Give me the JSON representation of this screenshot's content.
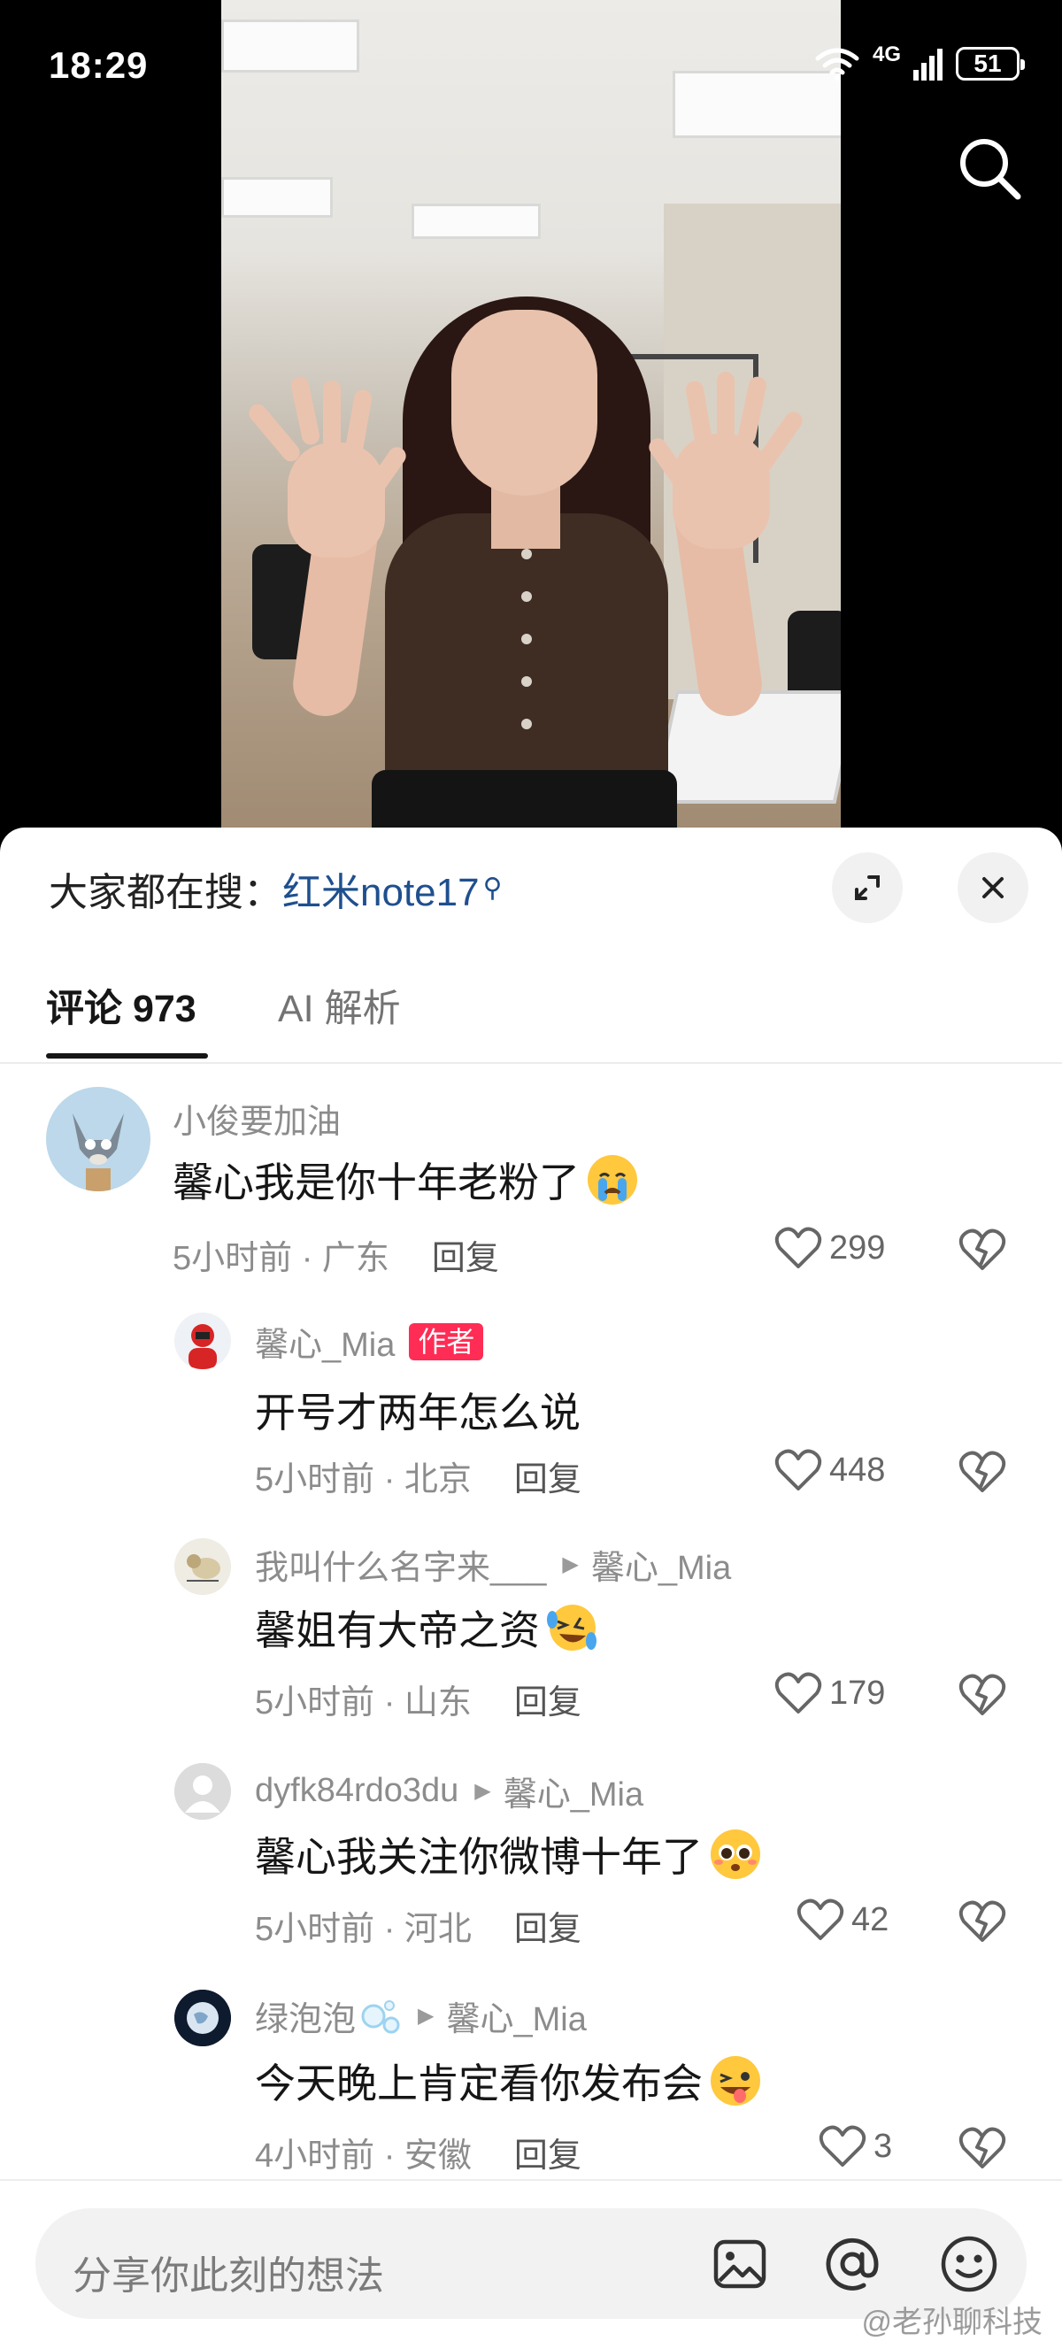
{
  "status_bar": {
    "time": "18:29",
    "network": "4G",
    "battery": "51"
  },
  "hot_search": {
    "prefix": "大家都在搜：",
    "keyword": "红米note17"
  },
  "tabs": [
    {
      "label": "评论 973",
      "active": true
    },
    {
      "label": "AI 解析",
      "active": false
    }
  ],
  "comments": [
    {
      "user": "小俊要加油",
      "text": "馨心我是你十年老粉了",
      "emoji": "crying-face",
      "time": "5小时前 · 广东",
      "reply": "回复",
      "likes": "299"
    },
    {
      "user": "馨心_Mia",
      "badge": "作者",
      "text": "开号才两年怎么说",
      "time": "5小时前 · 北京",
      "reply": "回复",
      "likes": "448"
    },
    {
      "user": "我叫什么名字来___",
      "reply_to": "馨心_Mia",
      "text": "馨姐有大帝之资",
      "emoji": "laughing-tears",
      "time": "5小时前 · 山东",
      "reply": "回复",
      "likes": "179"
    },
    {
      "user": "dyfk84rdo3du",
      "reply_to": "馨心_Mia",
      "text": "馨心我关注你微博十年了",
      "emoji": "pleading-face",
      "time": "5小时前 · 河北",
      "reply": "回复",
      "likes": "42"
    },
    {
      "user": "绿泡泡",
      "reply_to": "馨心_Mia",
      "text": "今天晚上肯定看你发布会",
      "emoji": "zany-face",
      "time": "4小时前 · 安徽",
      "reply": "回复",
      "likes": "3"
    }
  ],
  "input": {
    "placeholder": "分享你此刻的想法"
  },
  "watermark": "@老孙聊科技"
}
